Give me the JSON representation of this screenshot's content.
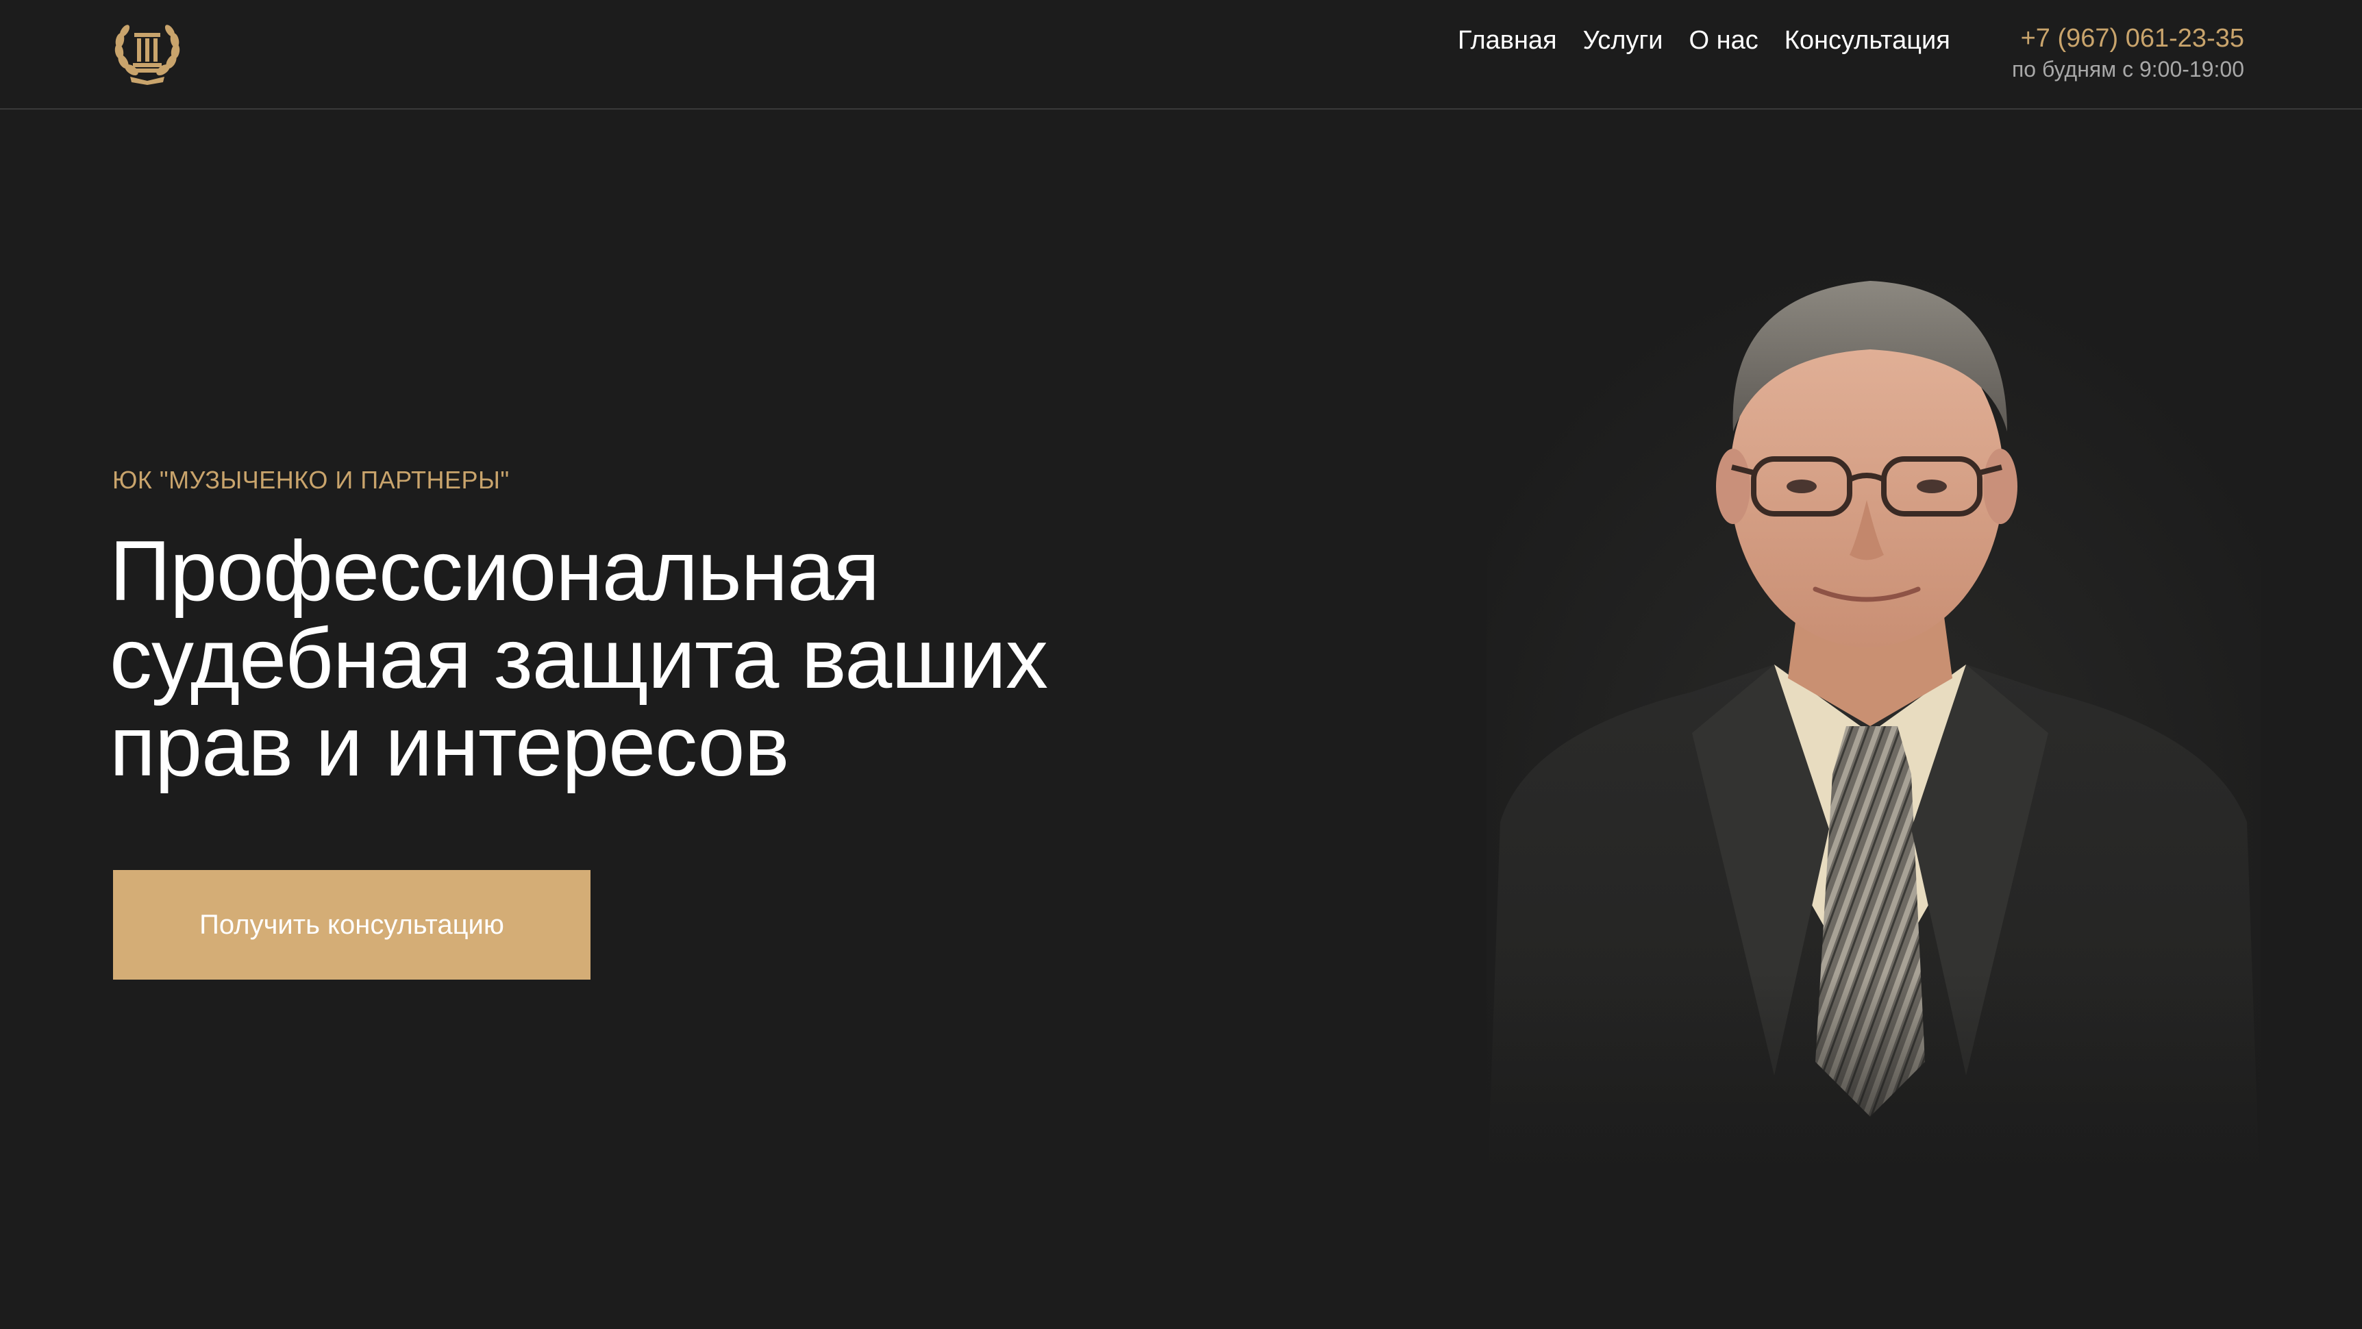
{
  "header": {
    "nav": [
      {
        "label": "Главная"
      },
      {
        "label": "Услуги"
      },
      {
        "label": "О нас"
      },
      {
        "label": "Консультация"
      }
    ],
    "phone": "+7 (967) 061-23-35",
    "hours": "по будням с 9:00-19:00"
  },
  "hero": {
    "eyebrow": "ЮК \"МУЗЫЧЕНКО И ПАРТНЕРЫ\"",
    "headline_lines": [
      "Профессиональная",
      "судебная защита ваших",
      "прав и интересов"
    ],
    "cta_label": "Получить консультацию"
  },
  "icons": {
    "logo": "laurel-wreath-column-logo"
  },
  "colors": {
    "background": "#1c1c1c",
    "accent": "#c9a46c",
    "button": "#d4ad76",
    "text": "#ffffff",
    "muted": "#a8a8a8"
  }
}
